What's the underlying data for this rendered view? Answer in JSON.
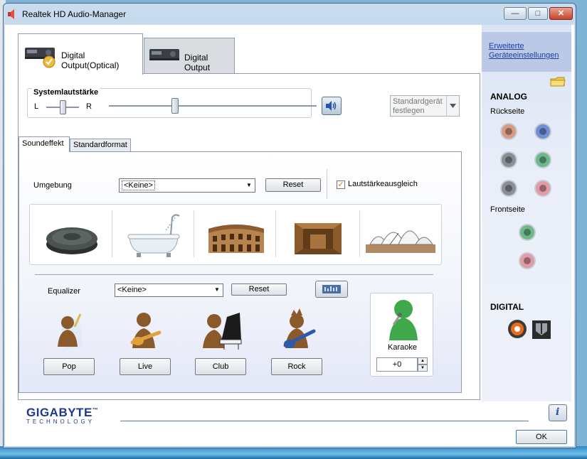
{
  "window": {
    "title": "Realtek HD Audio-Manager",
    "min_glyph": "—",
    "max_glyph": "□",
    "close_glyph": "✕"
  },
  "device_tabs": [
    {
      "label": "Digital Output(Optical)",
      "active": true
    },
    {
      "label": "Digital Output",
      "active": false
    }
  ],
  "volume": {
    "title": "Systemlautstärke",
    "left_label": "L",
    "right_label": "R",
    "balance": 0.5,
    "level": 0.32
  },
  "standard_device": {
    "label": "Standardgerät festlegen"
  },
  "sub_tabs": [
    {
      "label": "Soundeffekt",
      "active": true
    },
    {
      "label": "Standardformat",
      "active": false
    }
  ],
  "environment": {
    "label": "Umgebung",
    "selected": "<Keine>",
    "reset_label": "Reset",
    "loudness_label": "Lautstärkeausgleich",
    "loudness_checked": true,
    "items": [
      "stone-disc",
      "bathtub",
      "colosseum",
      "room",
      "opera-house"
    ]
  },
  "equalizer": {
    "label": "Equalizer",
    "selected": "<Keine>",
    "reset_label": "Reset",
    "presets": [
      {
        "label": "Pop",
        "icon": "pop-singer-icon"
      },
      {
        "label": "Live",
        "icon": "live-guitar-icon"
      },
      {
        "label": "Club",
        "icon": "club-piano-icon"
      },
      {
        "label": "Rock",
        "icon": "rock-guitar-icon"
      }
    ]
  },
  "karaoke": {
    "label": "Karaoke",
    "value": "+0"
  },
  "right_pane": {
    "advanced_link": "Erweiterte Geräteeinstellungen",
    "analog_title": "ANALOG",
    "rear_label": "Rückseite",
    "front_label": "Frontseite",
    "digital_title": "DIGITAL",
    "rear_jacks": [
      "#d89a80",
      "#6f8fd6",
      "#8a8f96",
      "#6cb98a",
      "#8a8f96",
      "#e39aa8"
    ],
    "front_jacks": [
      "#6cb98a",
      "#e39aa8"
    ]
  },
  "footer": {
    "logo_main": "GIGABYTE",
    "logo_tm": "™",
    "logo_sub": "TECHNOLOGY",
    "ok_label": "OK",
    "info_glyph": "i"
  },
  "colors": {
    "accent": "#1b3a8c",
    "link": "#1a3fa6",
    "checkmark": "#d77a10"
  }
}
